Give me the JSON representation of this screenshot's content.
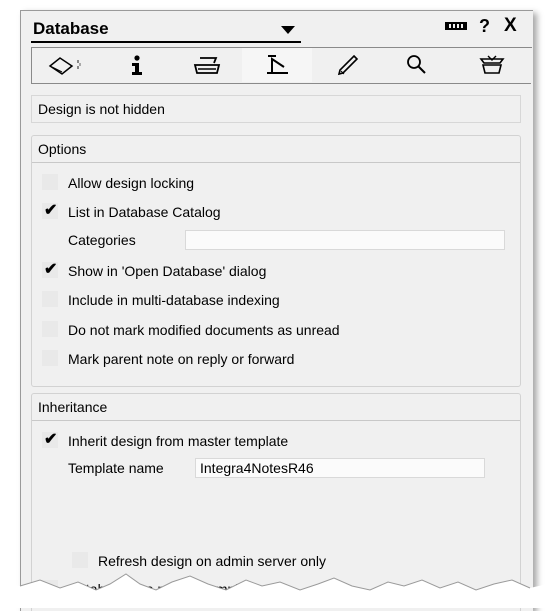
{
  "header": {
    "title": "Database",
    "help_glyph": "?",
    "close_glyph": "X"
  },
  "tabs": [
    {
      "icon": "info-tab-basics-icon"
    },
    {
      "icon": "info-icon"
    },
    {
      "icon": "printer-icon"
    },
    {
      "icon": "design-tab-icon"
    },
    {
      "icon": "pen-icon"
    },
    {
      "icon": "search-icon"
    },
    {
      "icon": "advanced-tab-icon"
    }
  ],
  "status": "Design is not hidden",
  "options": {
    "title": "Options",
    "items": [
      {
        "label": "Allow design locking",
        "checked": false
      },
      {
        "label": "List in Database Catalog",
        "checked": true
      },
      {
        "label": "Show in 'Open Database' dialog",
        "checked": true
      },
      {
        "label": "Include in multi-database indexing",
        "checked": false
      },
      {
        "label": "Do not mark modified documents as unread",
        "checked": false
      },
      {
        "label": "Mark parent note on reply or forward",
        "checked": false
      }
    ],
    "categories_label": "Categories",
    "categories_value": ""
  },
  "inheritance": {
    "title": "Inheritance",
    "inherit_label": "Inherit design from master template",
    "inherit_checked": true,
    "template_name_label": "Template name",
    "template_name_value": "Integra4NotesR46",
    "refresh_label": "Refresh design on admin server only",
    "refresh_checked": false,
    "master_label": "Database is a master template",
    "master_checked": false
  },
  "check_glyph": "✔"
}
